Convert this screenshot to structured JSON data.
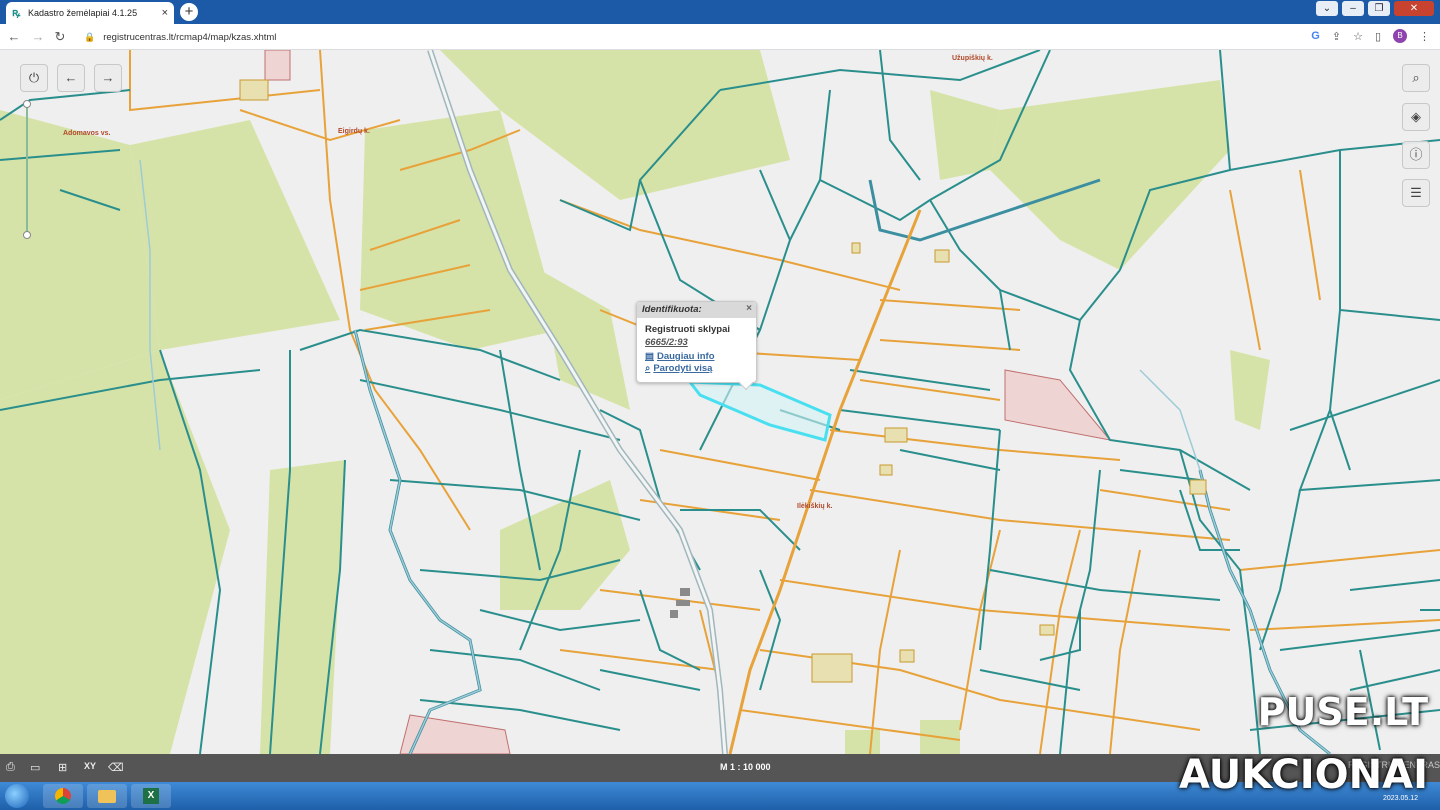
{
  "browser": {
    "tab_title": "Kadastro žemėlapiai 4.1.25",
    "tab_close": "×",
    "new_tab": "+",
    "url": "registrucentras.lt/rcmap4/map/kzas.xhtml",
    "profile_initial": "B"
  },
  "map": {
    "place_labels": [
      "Adomavos vs.",
      "Eigirdų k.",
      "Užupiškių k.",
      "Ilėkiškių k."
    ],
    "highlight_color": "#48e0f0"
  },
  "popup": {
    "header": "Identifikuota:",
    "close": "×",
    "section": "Registruoti sklypai",
    "parcel_id": "6665/2:93",
    "more_info": "Daugiau info",
    "show_all": "Parodyti visą"
  },
  "bottom_bar": {
    "scale": "M 1 : 10 000",
    "tools": [
      "print-icon",
      "measure-icon",
      "add-doc-icon",
      "xy-icon",
      "eraser-icon"
    ],
    "xy_label": "XY",
    "logo_text": "REGISTRŲ CENTRAS"
  },
  "taskbar": {
    "date": "2023.05.12"
  },
  "watermark": {
    "line1": "PUSE.LT",
    "line2": "AUKCIONAI"
  }
}
